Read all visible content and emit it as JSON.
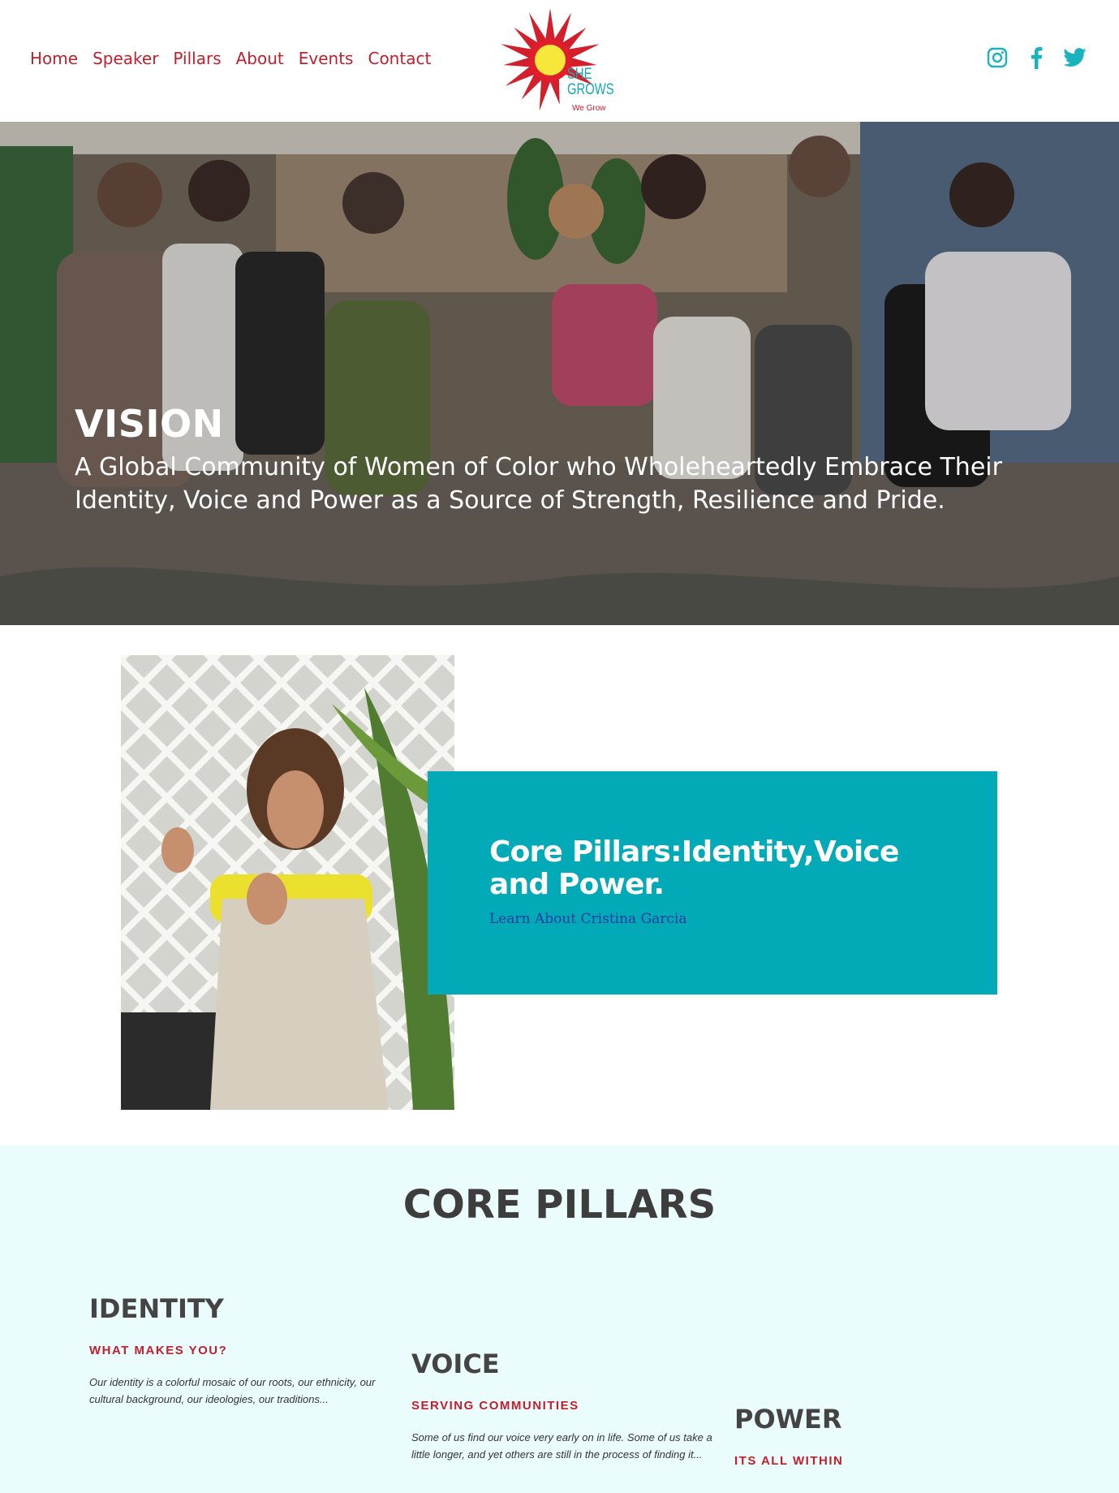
{
  "nav": {
    "items": [
      {
        "label": "Home"
      },
      {
        "label": "Speaker"
      },
      {
        "label": "Pillars"
      },
      {
        "label": "About"
      },
      {
        "label": "Events"
      },
      {
        "label": "Contact"
      }
    ]
  },
  "logo": {
    "line1": "SHE",
    "line2": "GROWS",
    "sub": "We Grow"
  },
  "social": {
    "icons": [
      "instagram-icon",
      "facebook-icon",
      "twitter-icon"
    ],
    "color": "#19b2bd"
  },
  "hero": {
    "title": "VISION",
    "subtitle": "A Global Community of Women of Color who Wholeheartedly Embrace Their Identity, Voice and Power as a Source of Strength, Resilience and Pride."
  },
  "speaker_card": {
    "heading": "Core Pillars:Identity,Voice and Power.",
    "link": "Learn About Cristina Garcia"
  },
  "pillars": {
    "title": "CORE PILLARS",
    "items": [
      {
        "title": "IDENTITY",
        "subtitle": "WHAT MAKES YOU?",
        "text": "Our identity is a colorful mosaic of our roots, our ethnicity, our cultural background, our ideologies, our traditions..."
      },
      {
        "title": "VOICE",
        "subtitle": "SERVING COMMUNITIES",
        "text": "Some of us find our voice very early on in life. Some of us take a little longer, and yet others are still in the process of finding it..."
      },
      {
        "title": "POWER",
        "subtitle": "ITS ALL WITHIN",
        "text": ""
      }
    ]
  },
  "colors": {
    "accent_red": "#c0202e",
    "teal": "#02a9b6",
    "link_blue": "#1b3ba7",
    "pillars_bg": "#ebfcfd"
  }
}
